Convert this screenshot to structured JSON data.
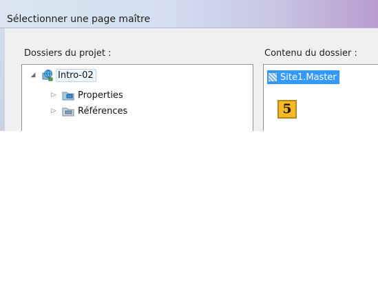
{
  "dialog": {
    "title": "Sélectionner une page maître"
  },
  "project_folders": {
    "label": "Dossiers du projet :",
    "items": [
      {
        "label": "Intro-02",
        "icon": "project-globe-icon",
        "expander": "◢"
      },
      {
        "label": "Properties",
        "icon": "properties-folder-icon",
        "expander": "▷"
      },
      {
        "label": "Références",
        "icon": "references-folder-icon",
        "expander": "▷"
      }
    ]
  },
  "folder_contents": {
    "label": "Contenu du dossier :",
    "items": [
      {
        "label": "Site1.Master",
        "icon": "master-file-icon"
      }
    ]
  },
  "annotation": {
    "number": "5"
  },
  "colors": {
    "selection": "#3399ff",
    "annotation_fill": "#f7ba24",
    "title_gradient_end": "#b99bd0"
  }
}
